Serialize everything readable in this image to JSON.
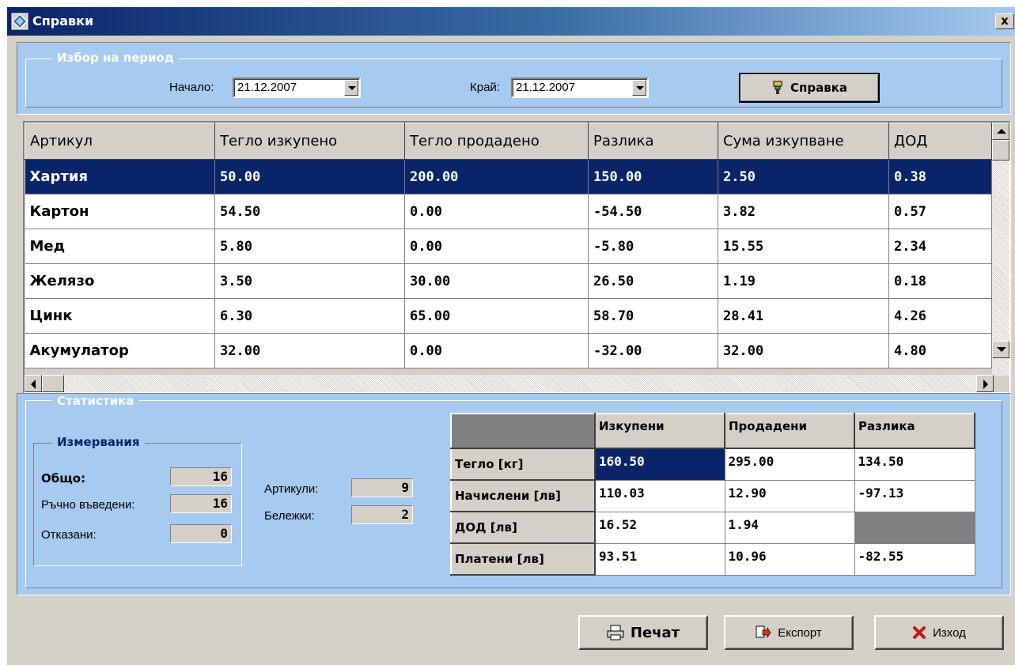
{
  "window": {
    "title": "Справки",
    "close_label": "x"
  },
  "period": {
    "legend": "Избор на период",
    "start_label": "Начало:",
    "start_value": "21.12.2007",
    "end_label": "Край:",
    "end_value": "21.12.2007",
    "report_button": "Справка"
  },
  "grid": {
    "columns": [
      "Артикул",
      "Тегло изкупено",
      "Тегло продадено",
      "Разлика",
      "Сума изкупване",
      "ДОД"
    ],
    "rows": [
      [
        "Хартия",
        "50.00",
        "200.00",
        "150.00",
        "2.50",
        "0.38"
      ],
      [
        "Картон",
        "54.50",
        "0.00",
        "-54.50",
        "3.82",
        "0.57"
      ],
      [
        "Мед",
        "5.80",
        "0.00",
        "-5.80",
        "15.55",
        "2.34"
      ],
      [
        "Желязо",
        "3.50",
        "30.00",
        "26.50",
        "1.19",
        "0.18"
      ],
      [
        "Цинк",
        "6.30",
        "65.00",
        "58.70",
        "28.41",
        "4.26"
      ],
      [
        "Акумулатор",
        "32.00",
        "0.00",
        "-32.00",
        "32.00",
        "4.80"
      ]
    ]
  },
  "statistics": {
    "legend": "Статистика",
    "measurements": {
      "legend": "Измервания",
      "total_label": "Общо:",
      "total_value": "16",
      "manual_label": "Ръчно въведени:",
      "manual_value": "16",
      "rejected_label": "Отказани:",
      "rejected_value": "0"
    },
    "articles_label": "Артикули:",
    "articles_value": "9",
    "notes_label": "Бележки:",
    "notes_value": "2",
    "summary": {
      "headers": [
        "",
        "Изкупени",
        "Продадени",
        "Разлика"
      ],
      "rows": [
        [
          "Тегло [кг]",
          "160.50",
          "295.00",
          "134.50"
        ],
        [
          "Начислени [лв]",
          "110.03",
          "12.90",
          "-97.13"
        ],
        [
          "ДОД [лв]",
          "16.52",
          "1.94",
          ""
        ],
        [
          "Платени [лв]",
          "93.51",
          "10.96",
          "-82.55"
        ]
      ]
    }
  },
  "footer": {
    "print": "Печат",
    "export": "Експорт",
    "exit": "Изход"
  },
  "colors": {
    "panel": "#a6caf0",
    "selection": "#0a246a",
    "face": "#d4d0c8"
  }
}
